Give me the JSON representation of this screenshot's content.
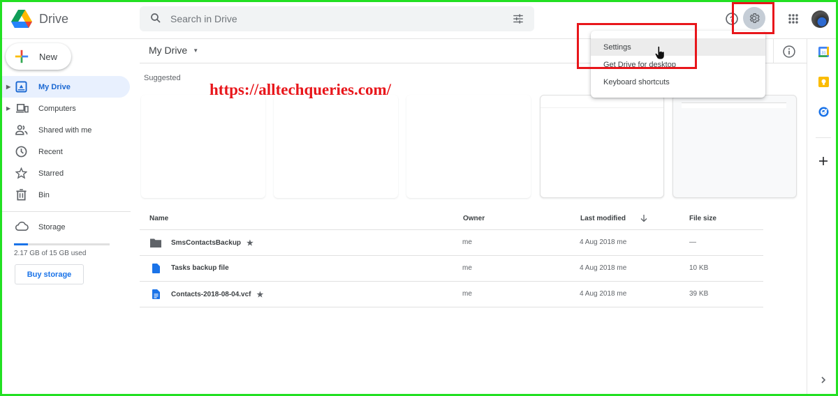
{
  "app": {
    "name": "Drive"
  },
  "search": {
    "placeholder": "Search in Drive"
  },
  "header": {
    "icons": [
      "search-icon",
      "filter-options-icon",
      "help-icon",
      "settings-icon",
      "apps-grid-icon",
      "account-avatar"
    ]
  },
  "settings_menu": {
    "items": [
      {
        "label": "Settings",
        "hovered": true
      },
      {
        "label": "Get Drive for desktop"
      },
      {
        "label": "Keyboard shortcuts"
      }
    ]
  },
  "sidebar": {
    "new_label": "New",
    "items": [
      {
        "label": "My Drive",
        "icon": "my-drive-icon",
        "active": true,
        "expandable": true
      },
      {
        "label": "Computers",
        "icon": "computers-icon",
        "expandable": true
      },
      {
        "label": "Shared with me",
        "icon": "shared-icon"
      },
      {
        "label": "Recent",
        "icon": "clock-icon"
      },
      {
        "label": "Starred",
        "icon": "star-icon"
      },
      {
        "label": "Bin",
        "icon": "bin-icon"
      }
    ],
    "storage": {
      "label": "Storage",
      "used_text": "2.17 GB of 15 GB used",
      "used_fraction": 0.145,
      "buy_label": "Buy storage"
    }
  },
  "main": {
    "breadcrumb": "My Drive",
    "suggested_label": "Suggested",
    "watermark": "https://alltechqueries.com/",
    "table": {
      "columns": [
        "Name",
        "Owner",
        "Last modified",
        "File size"
      ],
      "sort_icon": "arrow-down-icon",
      "rows": [
        {
          "name": "SmsContactsBackup",
          "type": "folder",
          "starred": true,
          "owner": "me",
          "modified": "4 Aug 2018",
          "modified_by": "me",
          "size": "—"
        },
        {
          "name": "Tasks backup file",
          "type": "file",
          "starred": false,
          "owner": "me",
          "modified": "4 Aug 2018",
          "modified_by": "me",
          "size": "10 KB"
        },
        {
          "name": "Contacts-2018-08-04.vcf",
          "type": "document",
          "starred": true,
          "owner": "me",
          "modified": "4 Aug 2018",
          "modified_by": "me",
          "size": "39 KB"
        }
      ]
    }
  },
  "right_panel": {
    "apps": [
      "calendar-icon",
      "keep-icon",
      "tasks-icon",
      "add-addon-icon"
    ]
  },
  "colors": {
    "accent": "#1a73e8",
    "active_bg": "#e8f0fe",
    "annotation_red": "#e8161b",
    "frame_green": "#22e022"
  }
}
